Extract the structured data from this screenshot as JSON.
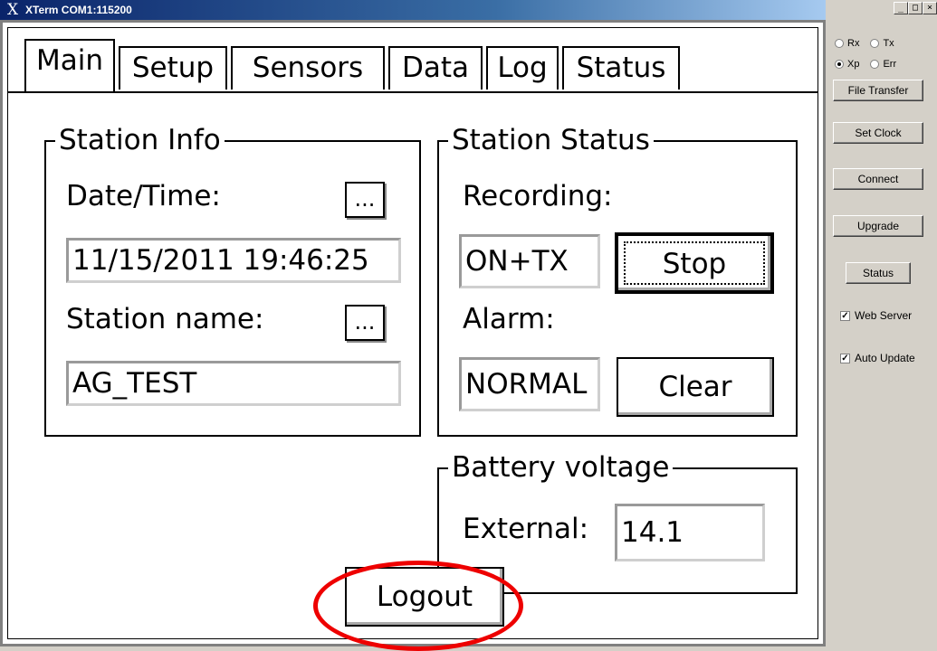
{
  "window": {
    "title": "XTerm COM1:115200",
    "icon": "x-logo-icon",
    "controls": [
      "_",
      "□",
      "×"
    ]
  },
  "tabs": [
    {
      "label": "Main",
      "active": true
    },
    {
      "label": "Setup",
      "active": false
    },
    {
      "label": "Sensors",
      "active": false
    },
    {
      "label": "Data",
      "active": false
    },
    {
      "label": "Log",
      "active": false
    },
    {
      "label": "Status",
      "active": false
    }
  ],
  "station_info": {
    "title": "Station Info",
    "datetime_label": "Date/Time:",
    "datetime_value": "11/15/2011 19:46:25",
    "name_label": "Station name:",
    "name_value": "AG_TEST",
    "ellipsis": "..."
  },
  "station_status": {
    "title": "Station Status",
    "recording_label": "Recording:",
    "recording_value": "ON+TX",
    "stop_label": "Stop",
    "alarm_label": "Alarm:",
    "alarm_value": "NORMAL",
    "clear_label": "Clear"
  },
  "battery": {
    "title": "Battery voltage",
    "external_label": "External:",
    "external_value": "14.1"
  },
  "logout_label": "Logout",
  "side_panel": {
    "radios": [
      {
        "label": "Rx",
        "selected": false
      },
      {
        "label": "Tx",
        "selected": false
      },
      {
        "label": "Xp",
        "selected": true
      },
      {
        "label": "Err",
        "selected": false
      }
    ],
    "buttons": {
      "file_transfer": "File Transfer",
      "set_clock": "Set Clock",
      "connect": "Connect",
      "upgrade": "Upgrade",
      "status": "Status"
    },
    "checkboxes": {
      "web_server": {
        "label": "Web Server",
        "checked": true
      },
      "auto_update": {
        "label": "Auto Update",
        "checked": true
      }
    }
  },
  "colors": {
    "titlebar": "#0a246a",
    "highlight": "#e00000",
    "panel": "#d4d0c8"
  }
}
